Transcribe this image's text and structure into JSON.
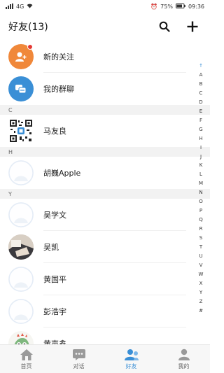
{
  "status_bar": {
    "left": "4G",
    "battery": "75%",
    "time": "09:36"
  },
  "header": {
    "title": "好友(13)",
    "search_icon": "search-icon",
    "add_icon": "plus-icon"
  },
  "top_items": [
    {
      "label": "新的关注",
      "icon": "new-follow-icon",
      "color": "#f0883a",
      "has_red_dot": true
    },
    {
      "label": "我的群聊",
      "icon": "group-chat-icon",
      "color": "#3a8fd6"
    }
  ],
  "sections": [
    {
      "letter": "C",
      "friends": [
        "马友良"
      ]
    },
    {
      "letter": "H",
      "friends": [
        "胡巍Apple"
      ]
    },
    {
      "letter": "Y",
      "friends": [
        "吴学文",
        "吴凯",
        "黄国平",
        "彭浩宇",
        "黄声鑫"
      ]
    }
  ],
  "index_letters": [
    "↑",
    "A",
    "B",
    "C",
    "D",
    "E",
    "F",
    "G",
    "H",
    "I",
    "J",
    "K",
    "L",
    "M",
    "N",
    "O",
    "P",
    "Q",
    "R",
    "S",
    "T",
    "U",
    "V",
    "W",
    "X",
    "Y",
    "Z",
    "#"
  ],
  "tabs": [
    {
      "label": "首页",
      "icon": "home-icon",
      "active": false
    },
    {
      "label": "对话",
      "icon": "chat-icon",
      "active": false
    },
    {
      "label": "好友",
      "icon": "friends-icon",
      "active": true
    },
    {
      "label": "我的",
      "icon": "profile-icon",
      "active": false
    }
  ],
  "colors": {
    "accent": "#3a8fd6",
    "orange": "#f0883a",
    "red_dot": "#e53935"
  }
}
